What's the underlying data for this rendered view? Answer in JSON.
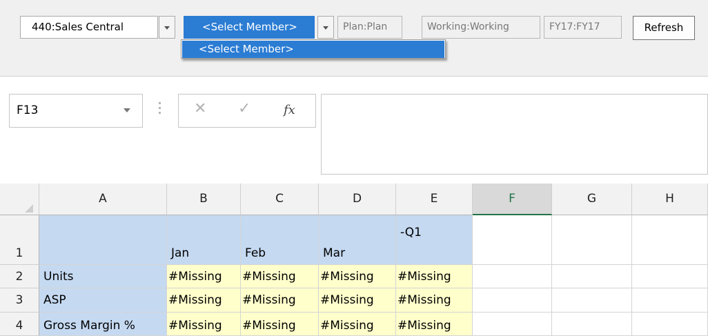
{
  "pov": {
    "entity": "440:Sales Central",
    "member_select": "<Select Member>",
    "scenario": "Plan:Plan",
    "version": "Working:Working",
    "year": "FY17:FY17",
    "refresh_label": "Refresh",
    "dropdown_items": [
      "<Select Member>"
    ]
  },
  "formula_bar": {
    "name_box": "F13",
    "cancel_symbol": "✕",
    "enter_symbol": "✓",
    "fx_symbol": "fx",
    "formula": ""
  },
  "grid": {
    "columns": [
      "A",
      "B",
      "C",
      "D",
      "E",
      "F",
      "G",
      "H"
    ],
    "selected_column": "F",
    "rows": [
      {
        "row": "1",
        "a": "",
        "b": "Jan",
        "c": "Feb",
        "d": "Mar",
        "e": "-Q1"
      },
      {
        "row": "2",
        "a": "Units",
        "b": "#Missing",
        "c": "#Missing",
        "d": "#Missing",
        "e": "#Missing"
      },
      {
        "row": "3",
        "a": "ASP",
        "b": "#Missing",
        "c": "#Missing",
        "d": "#Missing",
        "e": "#Missing"
      },
      {
        "row": "4",
        "a": "Gross Margin %",
        "b": "#Missing",
        "c": "#Missing",
        "d": "#Missing",
        "e": "#Missing"
      }
    ]
  },
  "colors": {
    "selection_blue": "#2b7cd3",
    "header_fill": "#c5d9f1",
    "data_fill": "#ffffcc",
    "excel_green": "#217346"
  },
  "icons": [
    "dropdown-arrow-icon",
    "cancel-icon",
    "enter-icon",
    "function-icon",
    "select-all-icon"
  ]
}
